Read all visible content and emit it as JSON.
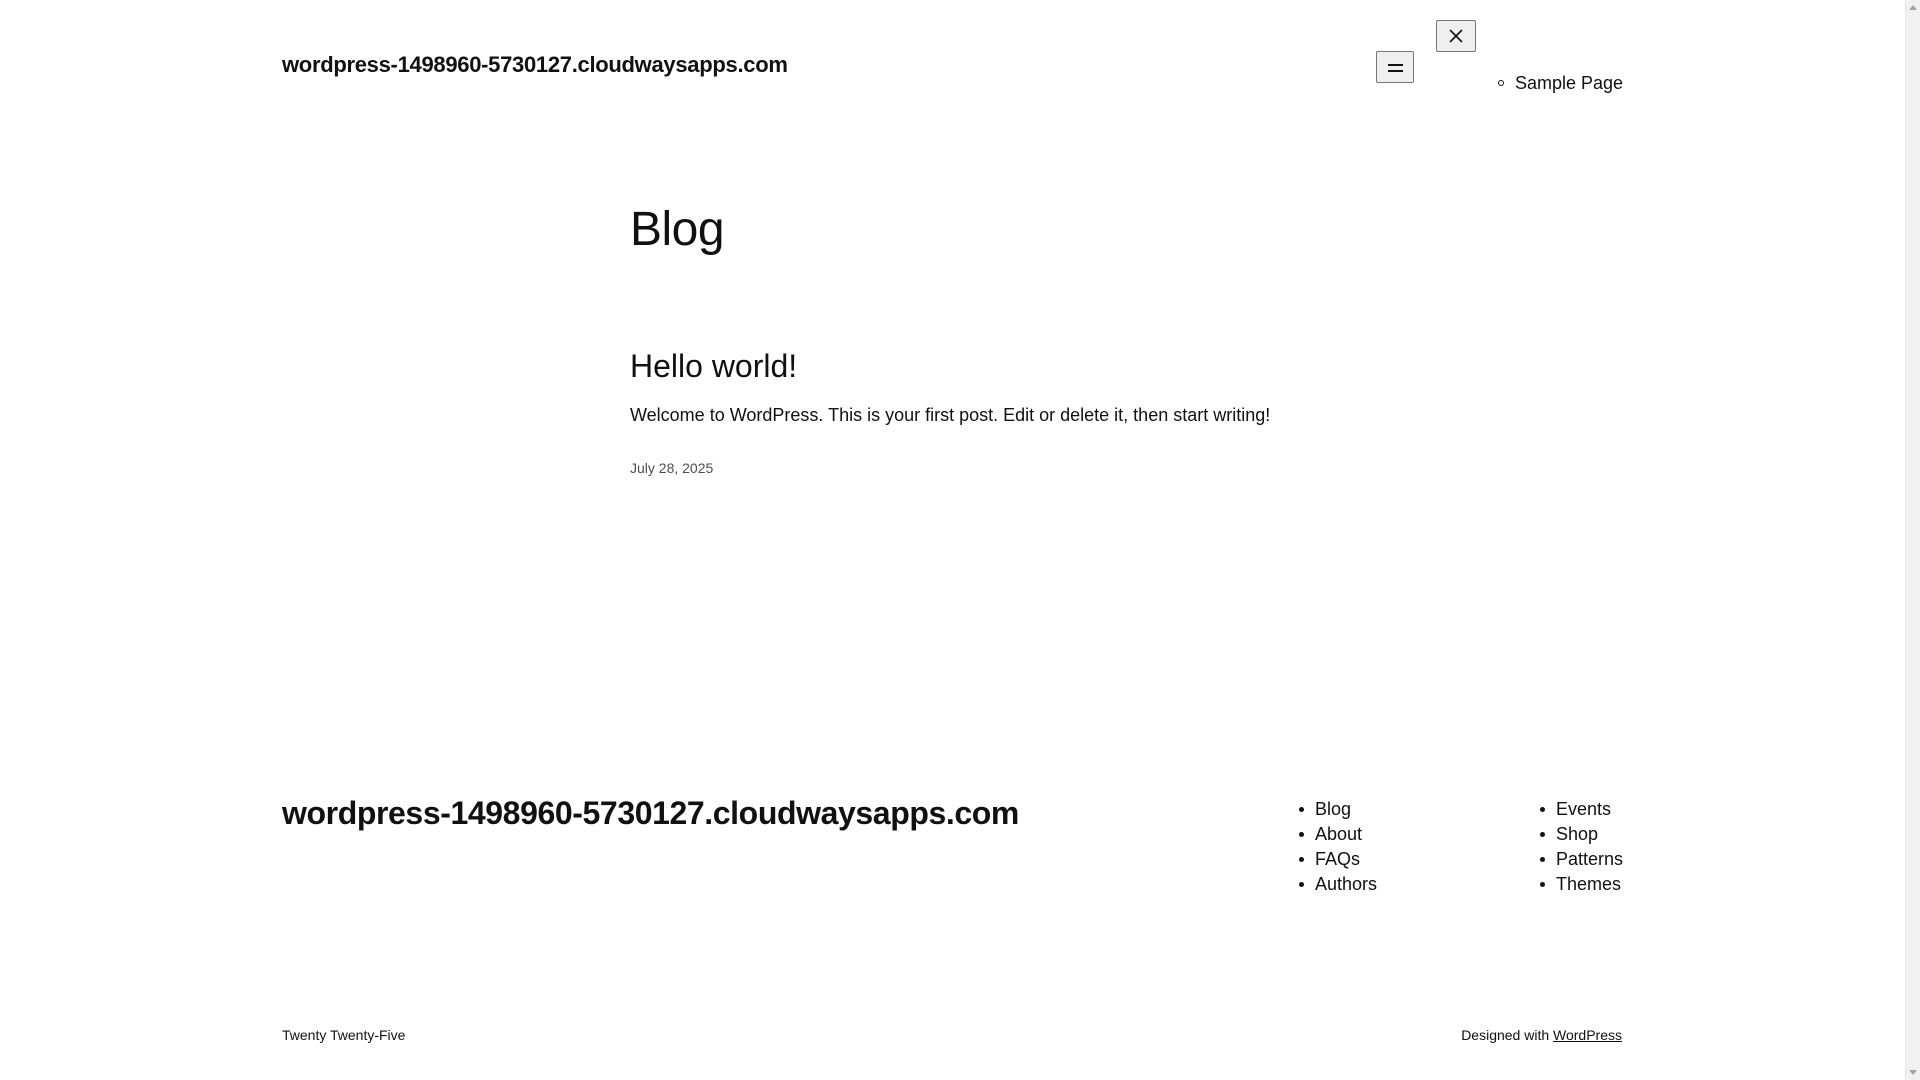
{
  "header": {
    "site_title": "wordpress-1498960-5730127.cloudwaysapps.com",
    "nav_items": [
      "Sample Page"
    ]
  },
  "main": {
    "page_title": "Blog",
    "posts": [
      {
        "title": "Hello world!",
        "excerpt": "Welcome to WordPress. This is your first post. Edit or delete it, then start writing!",
        "date": "July 28, 2025"
      }
    ]
  },
  "footer": {
    "site_title": "wordpress-1498960-5730127.cloudwaysapps.com",
    "nav_col1": [
      "Blog",
      "About",
      "FAQs",
      "Authors"
    ],
    "nav_col2": [
      "Events",
      "Shop",
      "Patterns",
      "Themes"
    ],
    "theme_credit": "Twenty Twenty-Five",
    "designed_with_prefix": "Designed with",
    "designed_with_link": "WordPress"
  },
  "icons": {
    "menu_open": "hamburger-icon",
    "menu_close": "close-icon"
  }
}
